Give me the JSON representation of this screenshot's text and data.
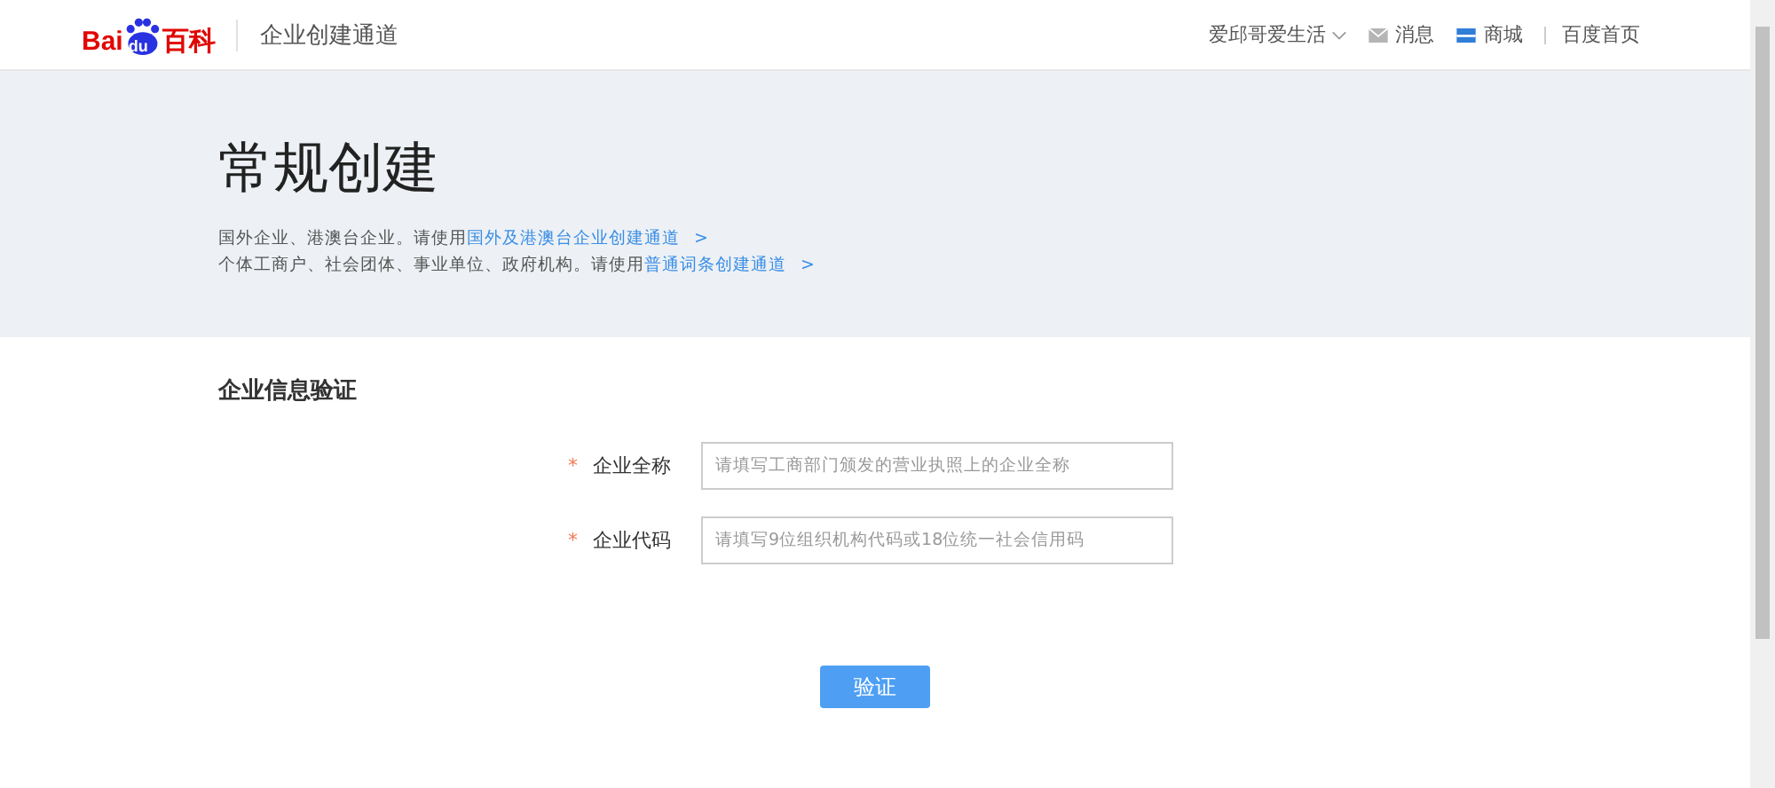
{
  "header": {
    "logo": {
      "left": "Bai",
      "paw": "du",
      "right": "百科"
    },
    "title": "企业创建通道",
    "user": {
      "label": "爱邱哥爱生活"
    },
    "messages": "消息",
    "shop": "商城",
    "home": "百度首页"
  },
  "banner": {
    "title": "常规创建",
    "lines": [
      {
        "text": "国外企业、港澳台企业。请使用",
        "link": "国外及港澳台企业创建通道",
        "arrow": ">"
      },
      {
        "text": "个体工商户、社会团体、事业单位、政府机构。请使用",
        "link": "普通词条创建通道",
        "arrow": ">"
      }
    ]
  },
  "form": {
    "heading": "企业信息验证",
    "fields": [
      {
        "required": true,
        "mark": "*",
        "label": "企业全称",
        "placeholder": "请填写工商部门颁发的营业执照上的企业全称"
      },
      {
        "required": true,
        "mark": "*",
        "label": "企业代码",
        "placeholder": "请填写9位组织机构代码或18位统一社会信用码"
      }
    ],
    "submit": "验证"
  }
}
